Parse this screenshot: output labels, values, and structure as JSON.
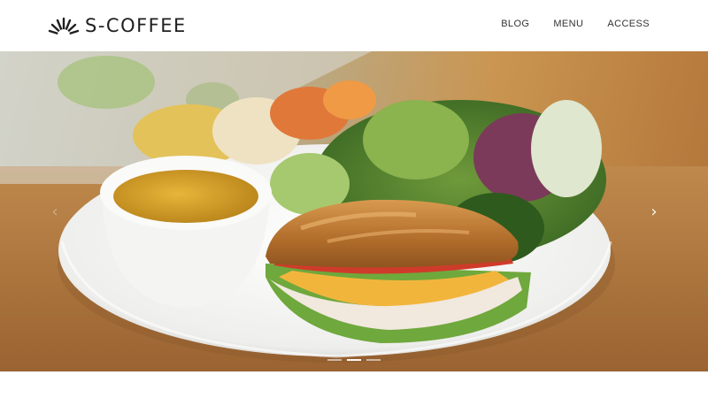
{
  "header": {
    "logo_text": "S-COFFEE",
    "logo_icon": "sunburst-icon",
    "nav": [
      {
        "label": "BLOG"
      },
      {
        "label": "MENU"
      },
      {
        "label": "ACCESS"
      }
    ]
  },
  "hero": {
    "image_subject": "cafe-lunch-plate-photo",
    "prev_arrow": "‹",
    "next_arrow": "›",
    "slides_count": 3,
    "active_slide": 1
  },
  "colors": {
    "logo": "#1f1f1f",
    "nav_text": "#333333",
    "background": "#ffffff",
    "table_wood": "#b8874f"
  }
}
